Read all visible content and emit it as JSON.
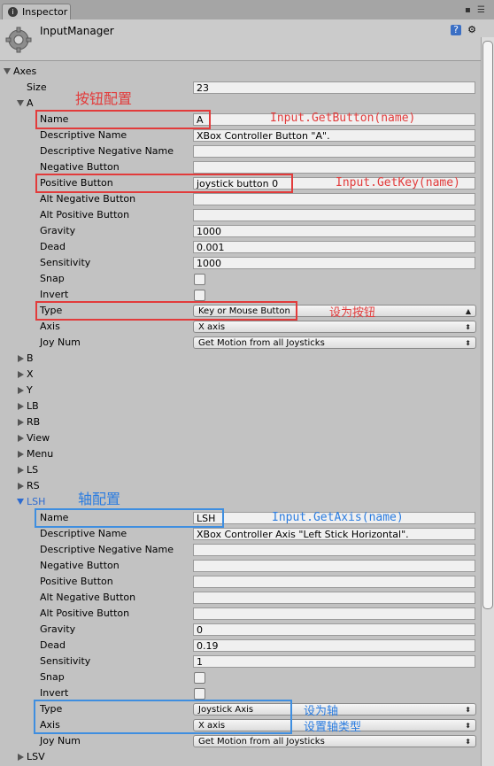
{
  "tab": {
    "icon": "inspector-icon",
    "label": "Inspector"
  },
  "header": {
    "title": "InputManager",
    "icons": [
      "help-book-icon",
      "gear-icon"
    ]
  },
  "colors": {
    "annotation_red": "#e23b3b",
    "annotation_blue": "#2a7ce0"
  },
  "axes": {
    "label": "Axes",
    "size_label": "Size",
    "size_value": "23",
    "a": {
      "label": "A",
      "name_label": "Name",
      "name_value": "A",
      "descriptive_name_label": "Descriptive Name",
      "descriptive_name_value": "XBox Controller Button \"A\".",
      "descriptive_negative_name_label": "Descriptive Negative Name",
      "negative_button_label": "Negative Button",
      "positive_button_label": "Positive Button",
      "positive_button_value": "joystick button 0",
      "alt_negative_button_label": "Alt Negative Button",
      "alt_positive_button_label": "Alt Positive Button",
      "gravity_label": "Gravity",
      "gravity_value": "1000",
      "dead_label": "Dead",
      "dead_value": "0.001",
      "sensitivity_label": "Sensitivity",
      "sensitivity_value": "1000",
      "snap_label": "Snap",
      "snap_checked": false,
      "invert_label": "Invert",
      "invert_checked": false,
      "type_label": "Type",
      "type_value": "Key or Mouse Button",
      "axis_label": "Axis",
      "axis_value": "X axis",
      "joy_num_label": "Joy Num",
      "joy_num_value": "Get Motion from all Joysticks"
    },
    "collapsed": [
      "B",
      "X",
      "Y",
      "LB",
      "RB",
      "View",
      "Menu",
      "LS",
      "RS"
    ],
    "lsh": {
      "label": "LSH",
      "name_label": "Name",
      "name_value": "LSH",
      "descriptive_name_label": "Descriptive Name",
      "descriptive_name_value": "XBox Controller Axis \"Left Stick Horizontal\".",
      "descriptive_negative_name_label": "Descriptive Negative Name",
      "negative_button_label": "Negative Button",
      "positive_button_label": "Positive Button",
      "alt_negative_button_label": "Alt Negative Button",
      "alt_positive_button_label": "Alt Positive Button",
      "gravity_label": "Gravity",
      "gravity_value": "0",
      "dead_label": "Dead",
      "dead_value": "0.19",
      "sensitivity_label": "Sensitivity",
      "sensitivity_value": "1",
      "snap_label": "Snap",
      "snap_checked": false,
      "invert_label": "Invert",
      "invert_checked": false,
      "type_label": "Type",
      "type_value": "Joystick Axis",
      "axis_label": "Axis",
      "axis_value": "X axis",
      "joy_num_label": "Joy Num",
      "joy_num_value": "Get Motion from all Joysticks"
    },
    "last": "LSV"
  },
  "annotations": {
    "button_config": "按钮配置",
    "get_button": "Input.GetButton(name)",
    "get_key": "Input.GetKey(name)",
    "set_as_button": "设为按钮",
    "axis_config": "轴配置",
    "get_axis": "Input.GetAxis(name)",
    "set_as_axis": "设为轴",
    "set_axis_type": "设置轴类型"
  }
}
